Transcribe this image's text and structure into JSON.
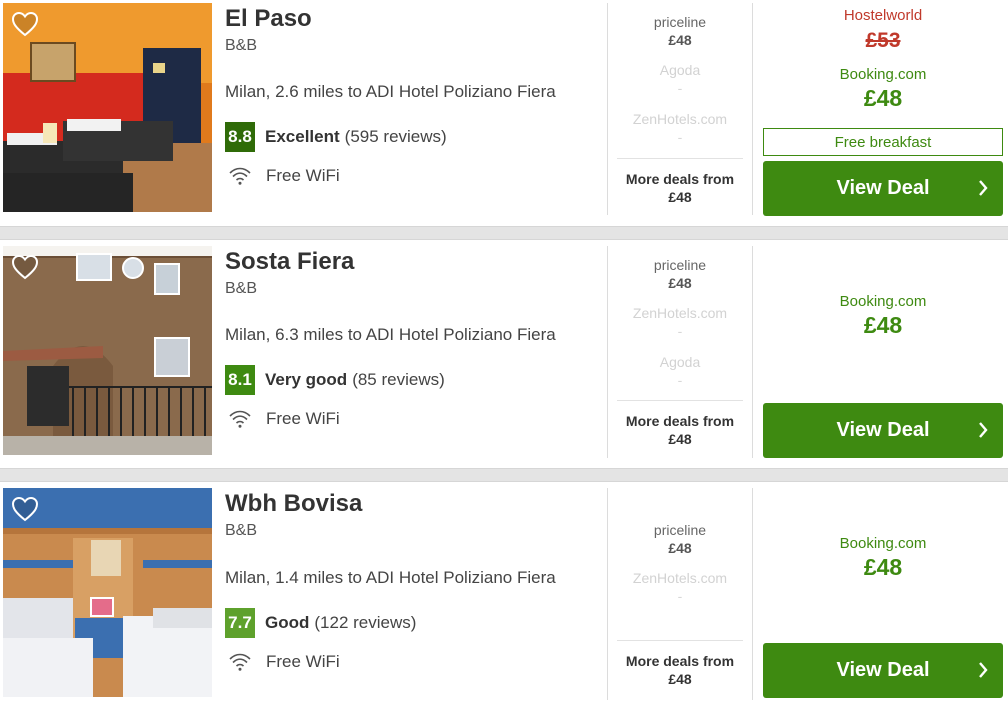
{
  "icons": {
    "favorite": "heart-outline-icon",
    "wifi": "wifi-icon",
    "chevron": "chevron-right-icon"
  },
  "colors": {
    "accent_green": "#3e8a11",
    "score_dark": "#2f6b08",
    "score_mid": "#3e8a11",
    "score_light": "#5ea12c",
    "strike_red": "#c0392b"
  },
  "hotels": [
    {
      "name": "El Paso",
      "type": "B&B",
      "distance": "Milan, 2.6 miles to ADI Hotel Poliziano Fiera",
      "score": "8.8",
      "rating_label": "Excellent",
      "reviews": "(595 reviews)",
      "amenity": "Free WiFi",
      "providers": [
        {
          "name": "priceline",
          "price": "£48"
        },
        {
          "name": "Agoda",
          "price": "-"
        },
        {
          "name": "ZenHotels.com",
          "price": "-"
        }
      ],
      "more_deals_label": "More deals from",
      "more_deals_price": "£48",
      "strike_site": "Hostelworld",
      "strike_price": "£53",
      "best_site": "Booking.com",
      "best_price": "£48",
      "tag": "Free breakfast",
      "cta": "View Deal"
    },
    {
      "name": "Sosta Fiera",
      "type": "B&B",
      "distance": "Milan, 6.3 miles to ADI Hotel Poliziano Fiera",
      "score": "8.1",
      "rating_label": "Very good",
      "reviews": "(85 reviews)",
      "amenity": "Free WiFi",
      "providers": [
        {
          "name": "priceline",
          "price": "£48"
        },
        {
          "name": "ZenHotels.com",
          "price": "-"
        },
        {
          "name": "Agoda",
          "price": "-"
        }
      ],
      "more_deals_label": "More deals from",
      "more_deals_price": "£48",
      "best_site": "Booking.com",
      "best_price": "£48",
      "cta": "View Deal"
    },
    {
      "name": "Wbh Bovisa",
      "type": "B&B",
      "distance": "Milan, 1.4 miles to ADI Hotel Poliziano Fiera",
      "score": "7.7",
      "rating_label": "Good",
      "reviews": "(122 reviews)",
      "amenity": "Free WiFi",
      "providers": [
        {
          "name": "priceline",
          "price": "£48"
        },
        {
          "name": "ZenHotels.com",
          "price": "-"
        }
      ],
      "more_deals_label": "More deals from",
      "more_deals_price": "£48",
      "best_site": "Booking.com",
      "best_price": "£48",
      "cta": "View Deal"
    }
  ]
}
